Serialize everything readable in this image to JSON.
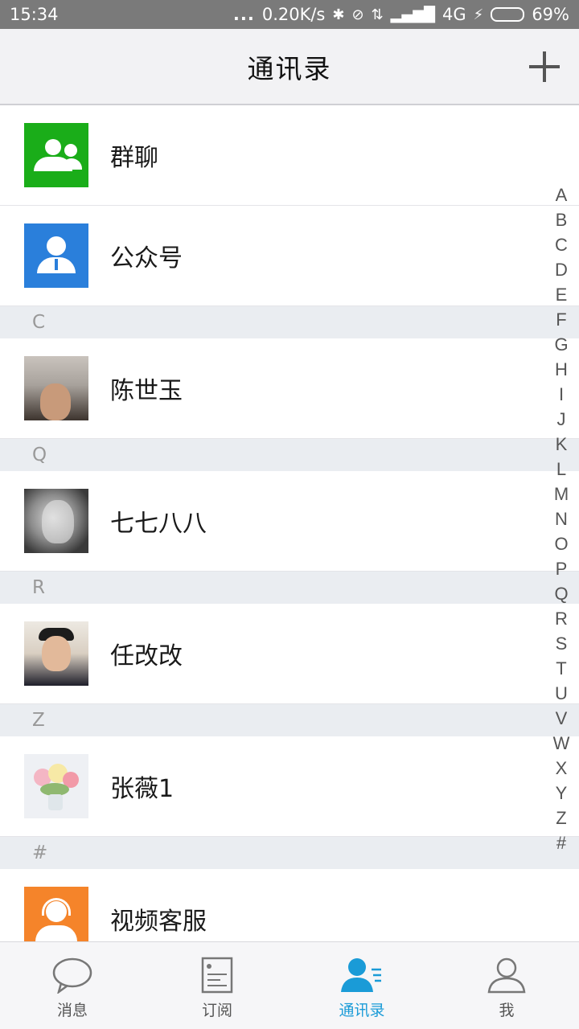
{
  "status_bar": {
    "time": "15:34",
    "dots": "...",
    "net_speed": "0.20K/s",
    "bluetooth": "✱",
    "mute": "⊘",
    "data_arrows": "⇅",
    "signal": "▂▄▆█",
    "network": "4G",
    "charging": "⚡",
    "battery": "69%",
    "battery_level": 0.69
  },
  "header": {
    "title": "通讯录",
    "add_icon": "plus-icon"
  },
  "contacts": [
    {
      "type": "row",
      "name": "群聊",
      "avatar": "group-chat-icon",
      "color": "#1aad19"
    },
    {
      "type": "row",
      "name": "公众号",
      "avatar": "official-account-icon",
      "color": "#2a7fdb"
    },
    {
      "type": "section",
      "label": "C"
    },
    {
      "type": "row",
      "name": "陈世玉",
      "avatar": "photo"
    },
    {
      "type": "section",
      "label": "Q"
    },
    {
      "type": "row",
      "name": "七七八八",
      "avatar": "photo"
    },
    {
      "type": "section",
      "label": "R"
    },
    {
      "type": "row",
      "name": "任改改",
      "avatar": "photo"
    },
    {
      "type": "section",
      "label": "Z"
    },
    {
      "type": "row",
      "name": "张薇1",
      "avatar": "photo"
    },
    {
      "type": "section",
      "label": "#"
    },
    {
      "type": "row",
      "name": "视频客服",
      "avatar": "customer-service-icon",
      "color": "#f5842a"
    }
  ],
  "alpha_index": [
    "A",
    "B",
    "C",
    "D",
    "E",
    "F",
    "G",
    "H",
    "I",
    "J",
    "K",
    "L",
    "M",
    "N",
    "O",
    "P",
    "Q",
    "R",
    "S",
    "T",
    "U",
    "V",
    "W",
    "X",
    "Y",
    "Z",
    "#"
  ],
  "tabs": [
    {
      "label": "消息",
      "icon": "chat-bubble-icon",
      "active": false
    },
    {
      "label": "订阅",
      "icon": "document-icon",
      "active": false
    },
    {
      "label": "通讯录",
      "icon": "contacts-icon",
      "active": true
    },
    {
      "label": "我",
      "icon": "user-icon",
      "active": false
    }
  ],
  "colors": {
    "accent": "#1a9bd7",
    "section_bg": "#eaedf1"
  }
}
